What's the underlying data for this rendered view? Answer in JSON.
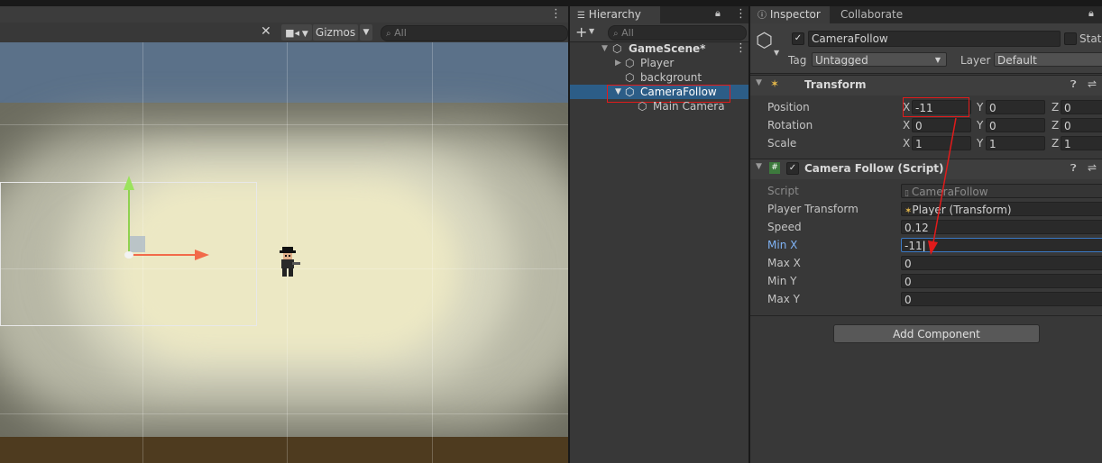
{
  "scene": {
    "gizmos_label": "Gizmos",
    "search_placeholder": "All",
    "icons": [
      "tools-icon",
      "camera-icon",
      "dropdown-icon",
      "more-icon",
      "search-icon"
    ]
  },
  "hierarchy": {
    "tab_label": "Hierarchy",
    "search_placeholder": "All",
    "scene_name": "GameScene*",
    "items": [
      {
        "label": "Player"
      },
      {
        "label": "backgrount"
      },
      {
        "label": "CameraFollow"
      },
      {
        "label": "Main Camera"
      }
    ]
  },
  "inspector": {
    "tabs": [
      {
        "label": "Inspector"
      },
      {
        "label": "Collaborate"
      }
    ],
    "object_name": "CameraFollow",
    "static_label": "Stati",
    "tag_label": "Tag",
    "tag_value": "Untagged",
    "layer_label": "Layer",
    "layer_value": "Default",
    "transform": {
      "title": "Transform",
      "rows": [
        {
          "label": "Position",
          "x": "-11",
          "y": "0",
          "z": "0"
        },
        {
          "label": "Rotation",
          "x": "0",
          "y": "0",
          "z": "0"
        },
        {
          "label": "Scale",
          "x": "1",
          "y": "1",
          "z": "1"
        }
      ],
      "axis_labels": [
        "X",
        "Y",
        "Z"
      ]
    },
    "script_component": {
      "title": "Camera Follow (Script)",
      "fields": [
        {
          "label": "Script",
          "value": "CameraFollow"
        },
        {
          "label": "Player Transform",
          "value": "Player (Transform)"
        },
        {
          "label": "Speed",
          "value": "0.12"
        },
        {
          "label": "Min X",
          "value": "-11"
        },
        {
          "label": "Max X",
          "value": "0"
        },
        {
          "label": "Min Y",
          "value": "0"
        },
        {
          "label": "Max Y",
          "value": "0"
        }
      ]
    },
    "add_component_label": "Add Component"
  },
  "colors": {
    "highlight_red": "#e11b1b",
    "selection_blue": "#2c5d87",
    "accent_blue": "#7fb3f5"
  }
}
